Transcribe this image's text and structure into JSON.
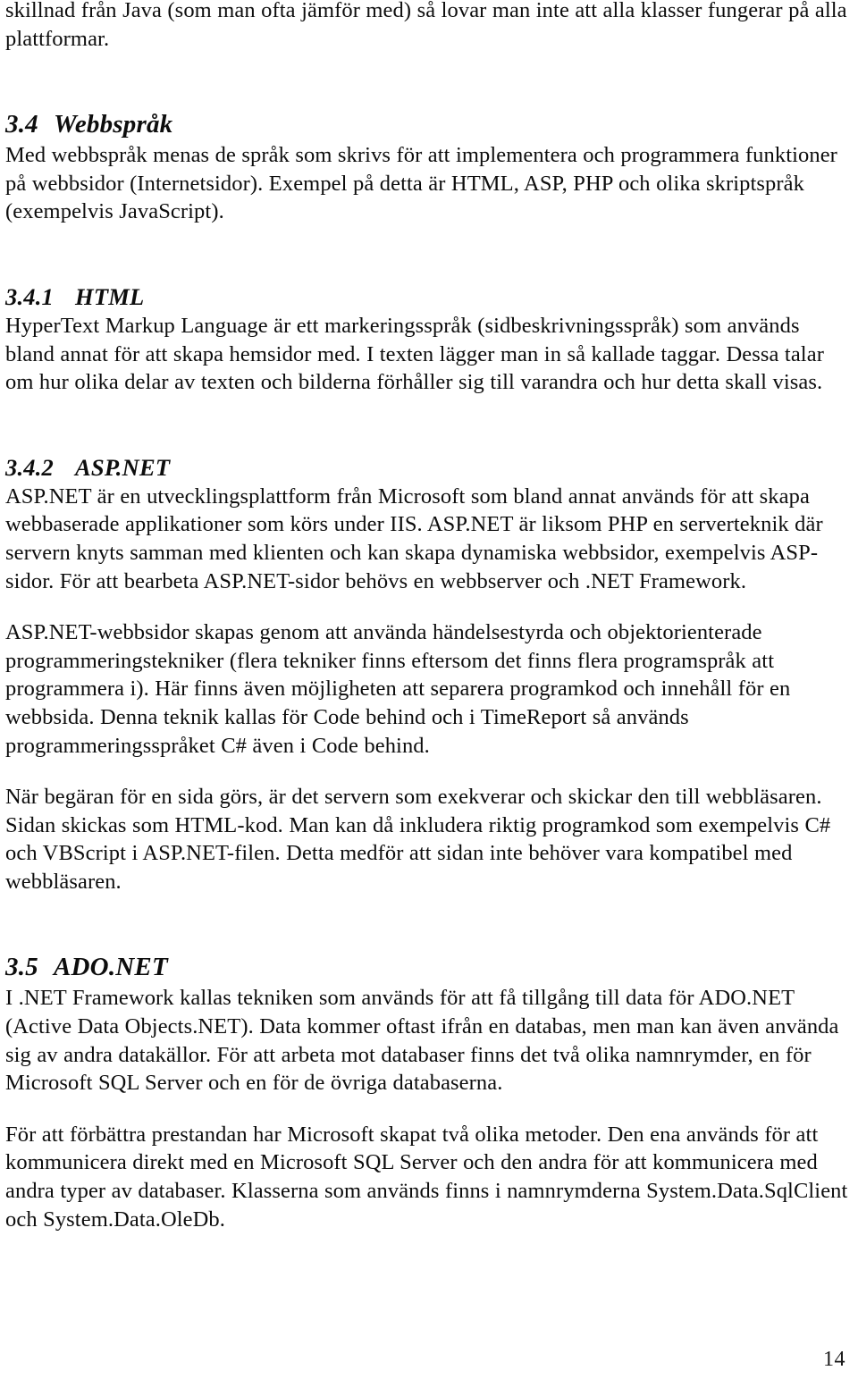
{
  "document": {
    "language": "sv",
    "page_number": "14"
  },
  "blocks": {
    "intro_paragraph": "skillnad från Java (som man ofta jämför med) så lovar man inte att alla klasser fungerar på alla plattformar.",
    "section_34": {
      "number": "3.4",
      "title": "Webbspråk",
      "paragraph": "Med webbspråk menas de språk som skrivs för att implementera och programmera funktioner på webbsidor (Internetsidor). Exempel på detta är HTML, ASP, PHP och olika skriptspråk (exempelvis JavaScript)."
    },
    "section_341": {
      "number": "3.4.1",
      "title": "HTML",
      "paragraph": "HyperText Markup Language är ett markeringsspråk (sidbeskrivningsspråk) som används bland annat för att skapa hemsidor med. I texten lägger man in så kallade taggar. Dessa talar om hur olika delar av texten och bilderna förhåller sig till varandra och hur detta skall visas."
    },
    "section_342": {
      "number": "3.4.2",
      "title": "ASP.NET",
      "paragraph_1": "ASP.NET är en utvecklingsplattform från Microsoft som bland annat används för att skapa webbaserade applikationer som körs under IIS. ASP.NET är liksom PHP en serverteknik där servern knyts samman med klienten och kan skapa dynamiska webbsidor, exempelvis ASP-sidor. För att bearbeta ASP.NET-sidor behövs en webbserver och .NET Framework.",
      "paragraph_2": "ASP.NET-webbsidor skapas genom att använda händelsestyrda och objektorienterade programmeringstekniker (flera tekniker finns eftersom det finns flera programspråk att programmera i). Här finns även möjligheten att separera programkod och innehåll för en webbsida. Denna teknik kallas för Code behind och i TimeReport så används programmeringsspråket C# även i Code behind.",
      "paragraph_3": "När begäran för en sida görs, är det servern som exekverar och skickar den till webbläsaren. Sidan skickas som HTML-kod. Man kan då inkludera riktig programkod som exempelvis C# och VBScript i ASP.NET-filen. Detta medför att sidan inte behöver vara kompatibel med webbläsaren."
    },
    "section_35": {
      "number": "3.5",
      "title": "ADO.NET",
      "paragraph_1": "I .NET Framework kallas tekniken som används för att få tillgång till data för ADO.NET (Active Data Objects.NET). Data kommer oftast ifrån en databas, men man kan även använda sig av andra datakällor. För att arbeta mot databaser finns det två olika namnrymder, en för Microsoft SQL Server och en för de övriga databaserna.",
      "paragraph_2": "För att förbättra prestandan har Microsoft skapat två olika metoder. Den ena används för att kommunicera direkt med en Microsoft SQL Server och den andra för att kommunicera med andra typer av databaser. Klasserna som används finns i namnrymderna System.Data.SqlClient och System.Data.OleDb."
    }
  }
}
